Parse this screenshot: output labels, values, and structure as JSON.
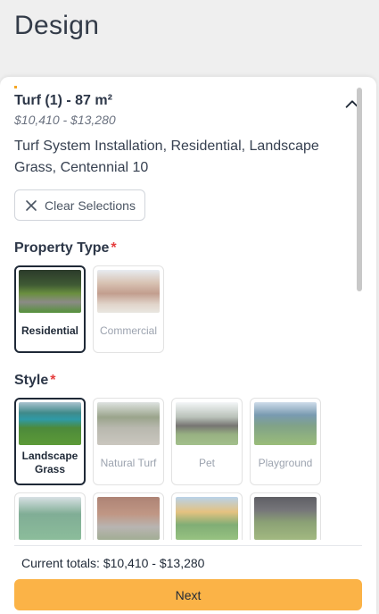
{
  "page": {
    "title": "Design"
  },
  "item": {
    "title": "Turf (1) - 87 m²",
    "price_range": "$10,410 - $13,280",
    "description": "Turf System Installation, Residential, Landscape Grass, Centennial 10"
  },
  "clear_button": {
    "label": "Clear Selections"
  },
  "property_type": {
    "label": "Property Type",
    "required_mark": "*",
    "options": [
      {
        "label": "Residential",
        "selected": true
      },
      {
        "label": "Commercial",
        "selected": false
      }
    ]
  },
  "style": {
    "label": "Style",
    "required_mark": "*",
    "options": [
      {
        "label": "Landscape Grass",
        "selected": true
      },
      {
        "label": "Natural Turf",
        "selected": false
      },
      {
        "label": "Pet",
        "selected": false
      },
      {
        "label": "Playground",
        "selected": false
      }
    ]
  },
  "footer": {
    "totals": "Current totals: $10,410 - $13,280",
    "next_label": "Next"
  },
  "colors": {
    "accent": "#fbb347",
    "required": "#e53e3e",
    "selected_border": "#1f2937"
  }
}
